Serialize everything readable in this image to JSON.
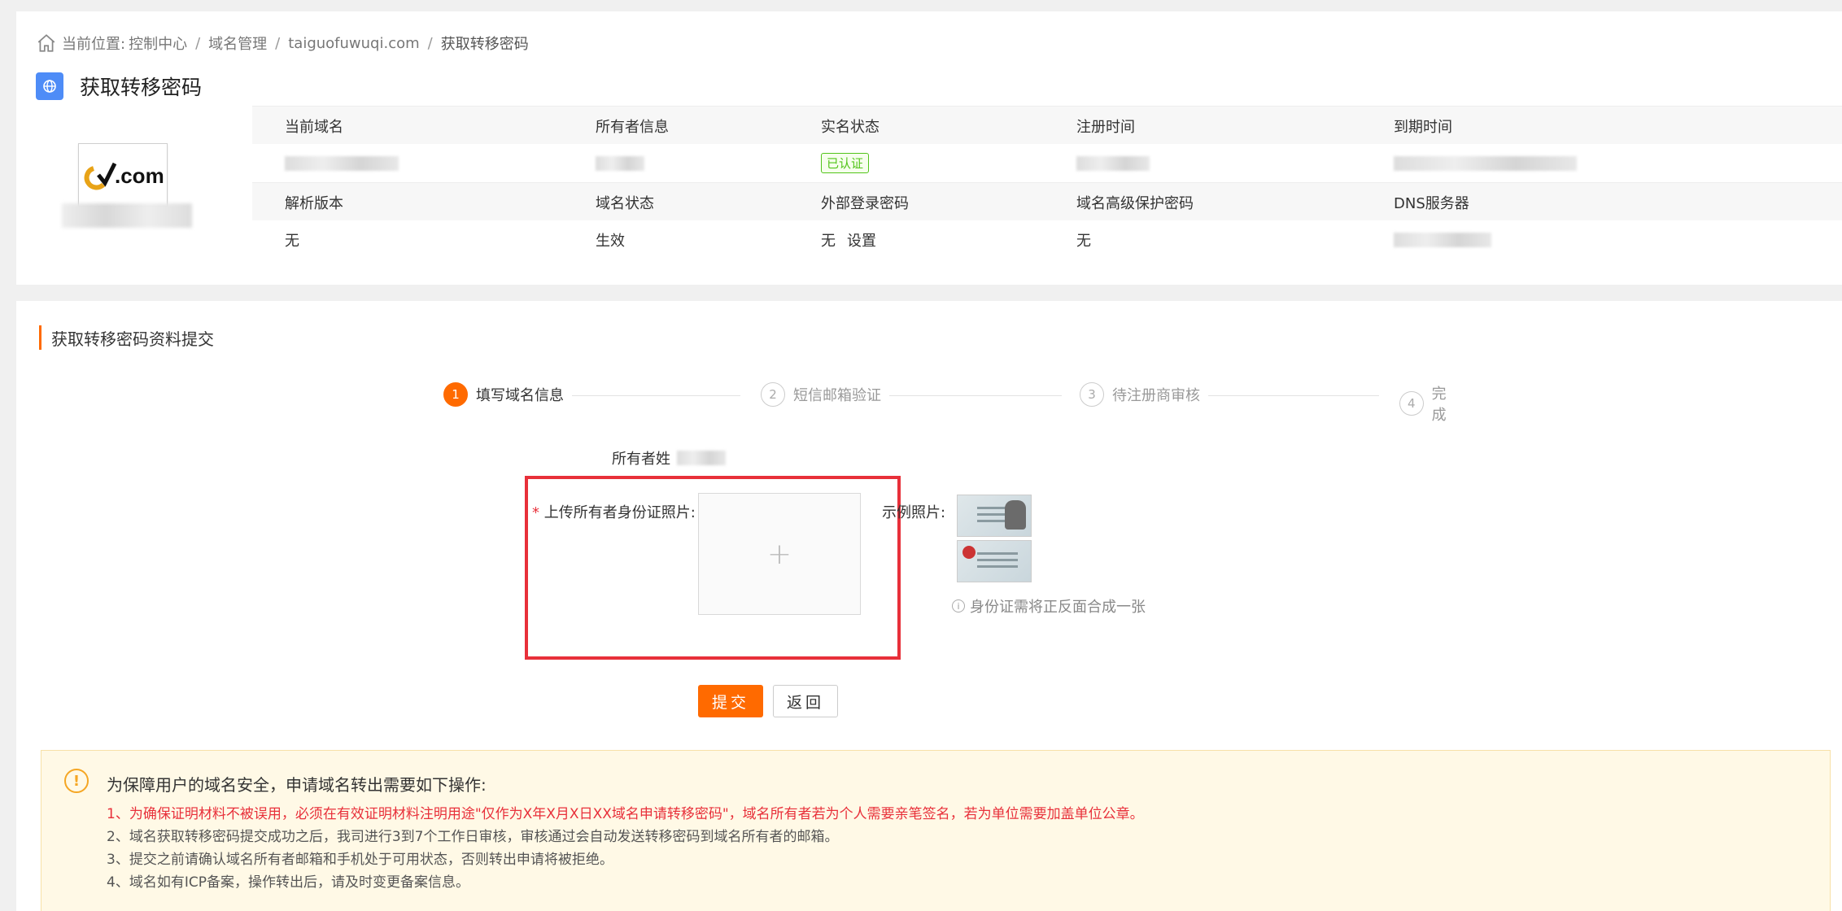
{
  "breadcrumb": {
    "prefix": "当前位置:",
    "items": [
      "控制中心",
      "域名管理",
      "taiguofuwuqi.com",
      "获取转移密码"
    ]
  },
  "page_title": "获取转移密码",
  "domain_logo_text": ".com",
  "info_table": {
    "headers_row1": [
      "当前域名",
      "所有者信息",
      "实名状态",
      "注册时间",
      "到期时间"
    ],
    "realname_status": "已认证",
    "headers_row2": [
      "解析版本",
      "域名状态",
      "外部登录密码",
      "域名高级保护密码",
      "DNS服务器"
    ],
    "values_row2": {
      "dns_version": "无",
      "domain_status": "生效",
      "external_password": "无",
      "external_password_action": "设置",
      "advanced_protection": "无"
    }
  },
  "section_title": "获取转移密码资料提交",
  "steps": [
    {
      "num": "1",
      "label": "填写域名信息"
    },
    {
      "num": "2",
      "label": "短信邮箱验证"
    },
    {
      "num": "3",
      "label": "待注册商审核"
    },
    {
      "num": "4",
      "label": "完成"
    }
  ],
  "form": {
    "owner_label": "所有者姓",
    "upload_required": "*",
    "upload_label": "上传所有者身份证照片:",
    "upload_plus": "+",
    "example_label": "示例照片:",
    "hint": "身份证需将正反面合成一张"
  },
  "buttons": {
    "submit": "提交",
    "back": "返回"
  },
  "notice": {
    "title": "为保障用户的域名安全，申请域名转出需要如下操作:",
    "items": [
      "1、为确保证明材料不被误用，必须在有效证明材料注明用途\"仅作为X年X月X日XX域名申请转移密码\"，域名所有者若为个人需要亲笔签名，若为单位需要加盖单位公章。",
      "2、域名获取转移密码提交成功之后，我司进行3到7个工作日审核，审核通过会自动发送转移密码到域名所有者的邮箱。",
      "3、提交之前请确认域名所有者邮箱和手机处于可用状态，否则转出申请将被拒绝。",
      "4、域名如有ICP备案，操作转出后，请及时变更备案信息。"
    ]
  },
  "colors": {
    "accent": "#ff6a00",
    "highlight": "#e8303a",
    "success": "#52c41a",
    "title_icon": "#4e8cf7"
  }
}
